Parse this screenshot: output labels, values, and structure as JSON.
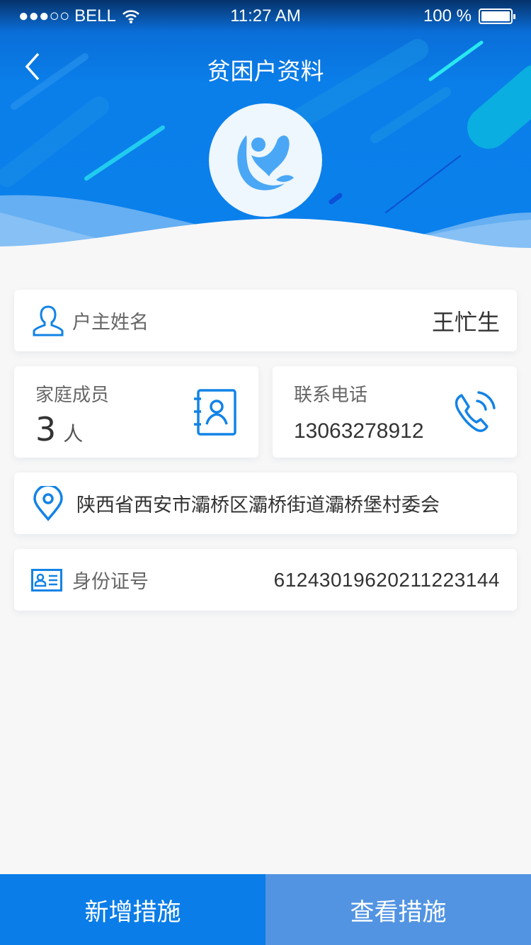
{
  "status_bar": {
    "carrier": "●●●○○ BELL",
    "time": "11:27 AM",
    "battery": "100 %"
  },
  "header": {
    "title": "贫困户资料"
  },
  "head_of_household": {
    "label": "户主姓名",
    "value": "王忙生"
  },
  "family": {
    "label": "家庭成员",
    "count": "3",
    "unit": "人"
  },
  "phone": {
    "label": "联系电话",
    "value": "13063278912"
  },
  "address": {
    "value": "陕西省西安市灞桥区灞桥街道灞桥堡村委会"
  },
  "id_card": {
    "label": "身份证号",
    "value": "612430196202112231 44"
  },
  "actions": {
    "add": "新增措施",
    "view": "查看措施"
  },
  "colors": {
    "primary": "#0a80ec",
    "add_button": "#0a7de8",
    "view_button": "#5294e2"
  }
}
